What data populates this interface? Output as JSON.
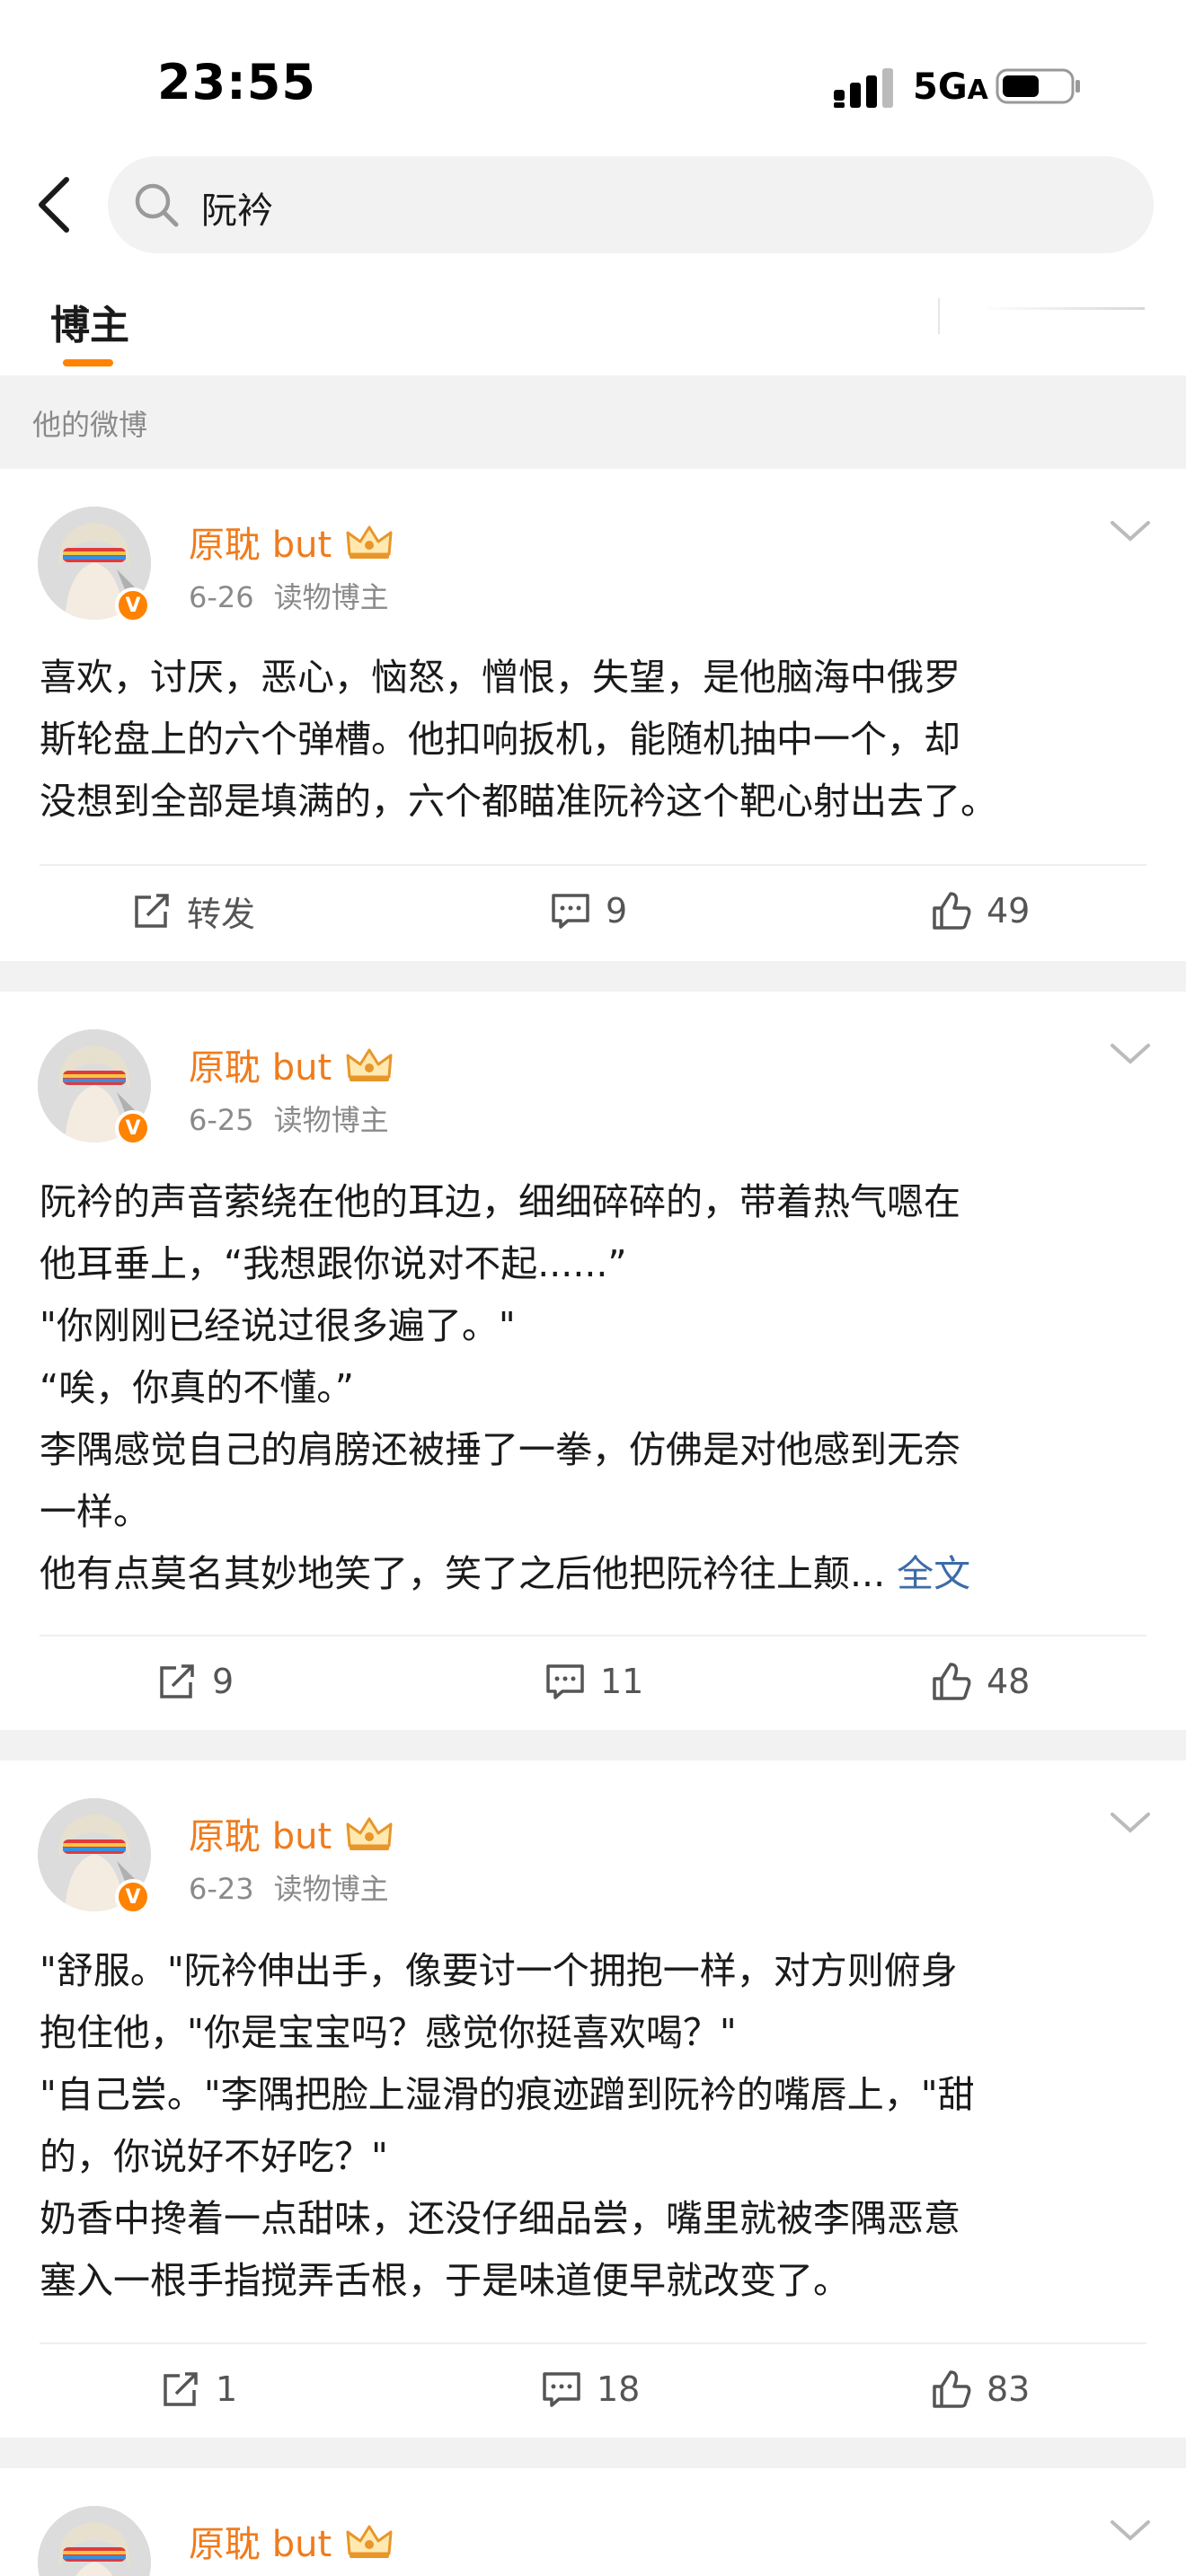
{
  "status_bar": {
    "time": "23:55",
    "network": "5G",
    "network_suffix": "A"
  },
  "search": {
    "query": "阮衿"
  },
  "tabs": [
    {
      "label": "博主"
    }
  ],
  "section_title": "他的微博",
  "posts": [
    {
      "author": "原耽 but",
      "date": "6-26",
      "tag": "读物博主",
      "lines": [
        "喜欢，讨厌，恶心，恼怒，憎恨，失望，是他脑海中俄罗",
        "斯轮盘上的六个弹槽。他扣响扳机，能随机抽中一个，却",
        "没想到全部是填满的，六个都瞄准阮衿这个靶心射出去了。"
      ],
      "repost": "转发",
      "comments": "9",
      "likes": "49"
    },
    {
      "author": "原耽 but",
      "date": "6-25",
      "tag": "读物博主",
      "lines": [
        "阮衿的声音萦绕在他的耳边，细细碎碎的，带着热气嗯在",
        "他耳垂上，“我想跟你说对不起......”",
        "\"你刚刚已经说过很多遍了。\"",
        "“唉，你真的不懂。”",
        "李隅感觉自己的肩膀还被捶了一拳，仿佛是对他感到无奈",
        "一样。",
        "他有点莫名其妙地笑了，笑了之后他把阮衿往上颠..."
      ],
      "full_text_link": "全文",
      "repost": "9",
      "comments": "11",
      "likes": "48"
    },
    {
      "author": "原耽 but",
      "date": "6-23",
      "tag": "读物博主",
      "lines": [
        "\"舒服。\"阮衿伸出手，像要讨一个拥抱一样，对方则俯身",
        "抱住他，\"你是宝宝吗？感觉你挺喜欢喝？\"",
        "\"自己尝。\"李隅把脸上湿滑的痕迹蹭到阮衿的嘴唇上，\"甜",
        "的，你说好不好吃？\"",
        "奶香中搀着一点甜味，还没仔细品尝，嘴里就被李隅恶意",
        "塞入一根手指搅弄舌根，于是味道便早就改变了。"
      ],
      "repost": "1",
      "comments": "18",
      "likes": "83"
    },
    {
      "author": "原耽 but"
    }
  ],
  "colors": {
    "accent": "#ff8200",
    "author": "#f07b1c",
    "link": "#3d6ba8",
    "gap": "#f2f2f2"
  }
}
